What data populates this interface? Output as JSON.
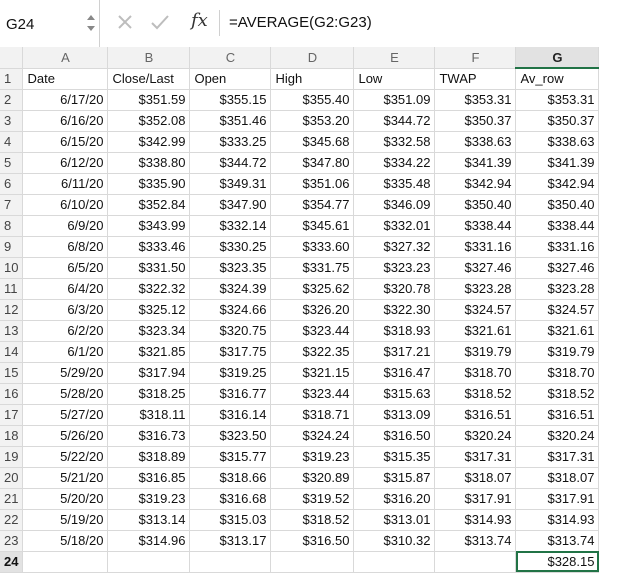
{
  "formula_bar": {
    "name_box": "G24",
    "formula": "=AVERAGE(G2:G23)",
    "fx_label": "fx",
    "cancel_icon": "close-icon",
    "enter_icon": "check-icon"
  },
  "sheet": {
    "columns": [
      "A",
      "B",
      "C",
      "D",
      "E",
      "F",
      "G"
    ],
    "selected_column": "G",
    "active_cell": "G24",
    "header_row": [
      "Date",
      "Close/Last",
      "Open",
      "High",
      "Low",
      "TWAP",
      "Av_row"
    ],
    "rows": [
      [
        "6/17/20",
        "$351.59",
        "$355.15",
        "$355.40",
        "$351.09",
        "$353.31",
        "$353.31"
      ],
      [
        "6/16/20",
        "$352.08",
        "$351.46",
        "$353.20",
        "$344.72",
        "$350.37",
        "$350.37"
      ],
      [
        "6/15/20",
        "$342.99",
        "$333.25",
        "$345.68",
        "$332.58",
        "$338.63",
        "$338.63"
      ],
      [
        "6/12/20",
        "$338.80",
        "$344.72",
        "$347.80",
        "$334.22",
        "$341.39",
        "$341.39"
      ],
      [
        "6/11/20",
        "$335.90",
        "$349.31",
        "$351.06",
        "$335.48",
        "$342.94",
        "$342.94"
      ],
      [
        "6/10/20",
        "$352.84",
        "$347.90",
        "$354.77",
        "$346.09",
        "$350.40",
        "$350.40"
      ],
      [
        "6/9/20",
        "$343.99",
        "$332.14",
        "$345.61",
        "$332.01",
        "$338.44",
        "$338.44"
      ],
      [
        "6/8/20",
        "$333.46",
        "$330.25",
        "$333.60",
        "$327.32",
        "$331.16",
        "$331.16"
      ],
      [
        "6/5/20",
        "$331.50",
        "$323.35",
        "$331.75",
        "$323.23",
        "$327.46",
        "$327.46"
      ],
      [
        "6/4/20",
        "$322.32",
        "$324.39",
        "$325.62",
        "$320.78",
        "$323.28",
        "$323.28"
      ],
      [
        "6/3/20",
        "$325.12",
        "$324.66",
        "$326.20",
        "$322.30",
        "$324.57",
        "$324.57"
      ],
      [
        "6/2/20",
        "$323.34",
        "$320.75",
        "$323.44",
        "$318.93",
        "$321.61",
        "$321.61"
      ],
      [
        "6/1/20",
        "$321.85",
        "$317.75",
        "$322.35",
        "$317.21",
        "$319.79",
        "$319.79"
      ],
      [
        "5/29/20",
        "$317.94",
        "$319.25",
        "$321.15",
        "$316.47",
        "$318.70",
        "$318.70"
      ],
      [
        "5/28/20",
        "$318.25",
        "$316.77",
        "$323.44",
        "$315.63",
        "$318.52",
        "$318.52"
      ],
      [
        "5/27/20",
        "$318.11",
        "$316.14",
        "$318.71",
        "$313.09",
        "$316.51",
        "$316.51"
      ],
      [
        "5/26/20",
        "$316.73",
        "$323.50",
        "$324.24",
        "$316.50",
        "$320.24",
        "$320.24"
      ],
      [
        "5/22/20",
        "$318.89",
        "$315.77",
        "$319.23",
        "$315.35",
        "$317.31",
        "$317.31"
      ],
      [
        "5/21/20",
        "$316.85",
        "$318.66",
        "$320.89",
        "$315.87",
        "$318.07",
        "$318.07"
      ],
      [
        "5/20/20",
        "$319.23",
        "$316.68",
        "$319.52",
        "$316.20",
        "$317.91",
        "$317.91"
      ],
      [
        "5/19/20",
        "$313.14",
        "$315.03",
        "$318.52",
        "$313.01",
        "$314.93",
        "$314.93"
      ],
      [
        "5/18/20",
        "$314.96",
        "$313.17",
        "$316.50",
        "$310.32",
        "$313.74",
        "$313.74"
      ]
    ],
    "total_row": [
      "",
      "",
      "",
      "",
      "",
      "",
      "$328.15"
    ],
    "row_numbers": [
      "1",
      "2",
      "3",
      "4",
      "5",
      "6",
      "7",
      "8",
      "9",
      "10",
      "11",
      "12",
      "13",
      "14",
      "15",
      "16",
      "17",
      "18",
      "19",
      "20",
      "21",
      "22",
      "23",
      "24"
    ]
  }
}
